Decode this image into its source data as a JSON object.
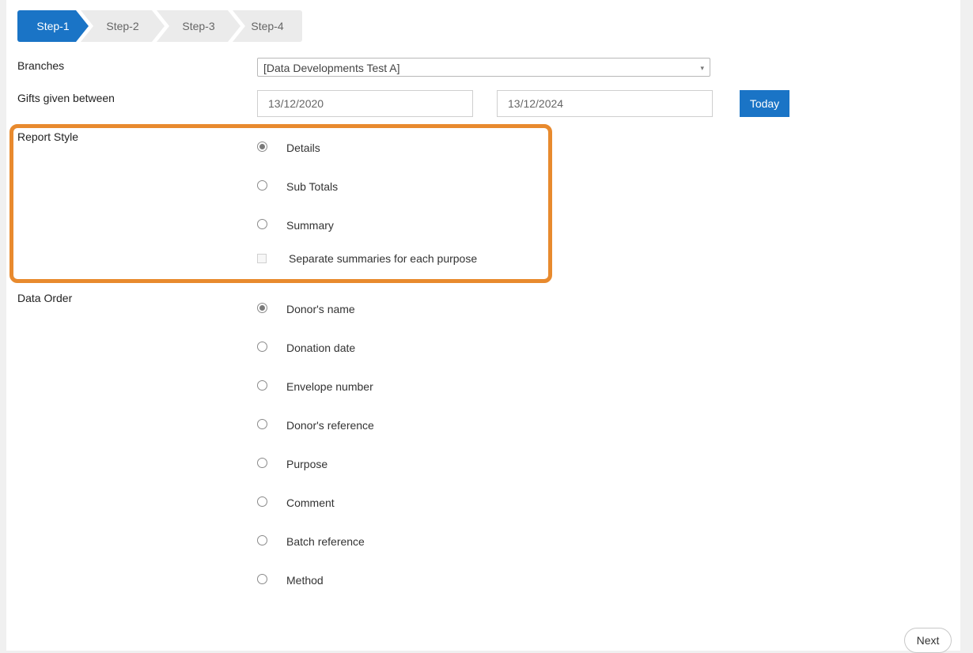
{
  "steps": [
    "Step-1",
    "Step-2",
    "Step-3",
    "Step-4"
  ],
  "branches": {
    "label": "Branches",
    "selected": "[Data Developments Test A]",
    "arrow_icon": "▾"
  },
  "gifts": {
    "label": "Gifts given between",
    "from": "13/12/2020",
    "to": "13/12/2024",
    "today_label": "Today"
  },
  "report_style": {
    "label": "Report Style",
    "options": [
      "Details",
      "Sub Totals",
      "Summary"
    ],
    "selected_index": 0,
    "separate_label": "Separate summaries for each purpose"
  },
  "data_order": {
    "label": "Data Order",
    "options": [
      "Donor's name",
      "Donation date",
      "Envelope number",
      "Donor's reference",
      "Purpose",
      "Comment",
      "Batch reference",
      "Method"
    ],
    "selected_index": 0
  },
  "next_label": "Next",
  "colors": {
    "accent": "#1a74c6",
    "highlight": "#e88a2e"
  }
}
